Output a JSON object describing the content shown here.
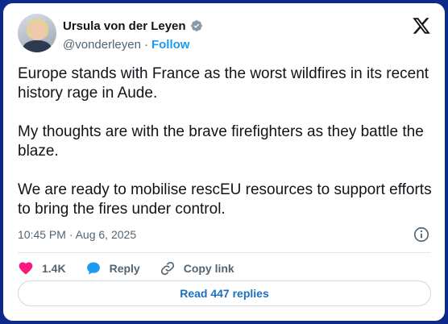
{
  "author": {
    "name": "Ursula von der Leyen",
    "handle": "@vonderleyen",
    "separator": "·",
    "follow_label": "Follow",
    "verified": true
  },
  "tweet": {
    "paragraphs": [
      "Europe stands with France as the worst wildfires in its recent history rage in Aude.",
      "My thoughts are with the brave firefighters as they battle the blaze.",
      "We are ready to mobilise rescEU resources to support efforts to bring the fires under control."
    ],
    "timestamp": "10:45 PM · Aug 6, 2025"
  },
  "actions": {
    "likes": "1.4K",
    "reply_label": "Reply",
    "copy_link_label": "Copy link"
  },
  "replies_button": "Read 447 replies",
  "icons": {
    "verified": "verified-badge-icon",
    "logo": "x-logo-icon",
    "info": "info-icon",
    "like": "heart-icon",
    "reply": "speech-bubble-icon",
    "copy": "link-icon"
  },
  "colors": {
    "background": "#0d2a8a",
    "text": "#0f1419",
    "muted": "#536471",
    "accent": "#1d9bf0",
    "like": "#f91880",
    "reply": "#1d9bf0"
  }
}
